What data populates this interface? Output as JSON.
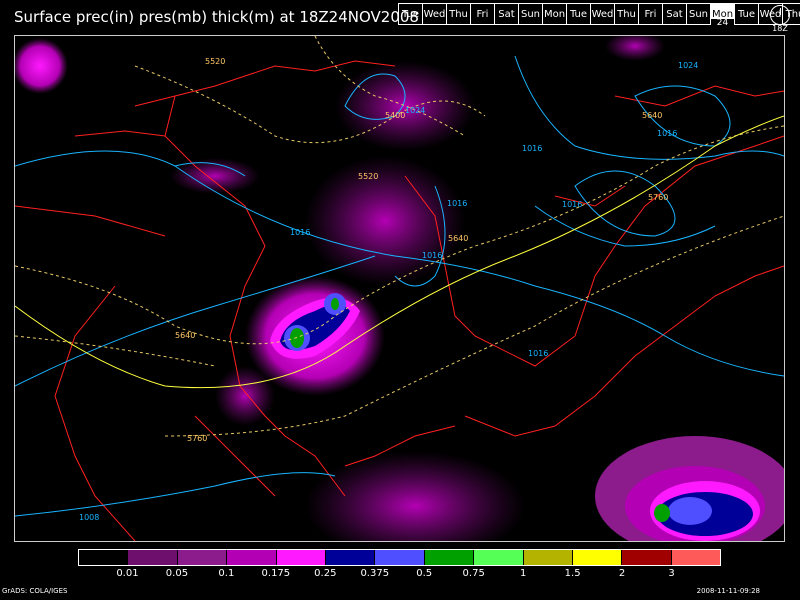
{
  "title": "Surface prec(in) pres(mb) thick(m) at 18Z24NOV2008",
  "days": [
    {
      "label": "Tue"
    },
    {
      "label": "Wed"
    },
    {
      "label": "Thu"
    },
    {
      "label": "Fri"
    },
    {
      "label": "Sat"
    },
    {
      "label": "Sun"
    },
    {
      "label": "Mon"
    },
    {
      "label": "Tue"
    },
    {
      "label": "Wed"
    },
    {
      "label": "Thu"
    },
    {
      "label": "Fri"
    },
    {
      "label": "Sat"
    },
    {
      "label": "Sun"
    },
    {
      "label": "Mon",
      "date": "24",
      "active": true
    },
    {
      "label": "Tue"
    },
    {
      "label": "Wed"
    },
    {
      "label": "Thu"
    }
  ],
  "clock_label": "18Z",
  "map": {
    "pressure_labels": [
      "1016",
      "1016",
      "1016",
      "1016",
      "1016",
      "1016",
      "1016",
      "1024",
      "1024",
      "1008"
    ],
    "thickness_labels": [
      "5520",
      "5400",
      "5520",
      "5640",
      "5640",
      "5760",
      "5760",
      "5640"
    ]
  },
  "legend": {
    "colors": [
      "#000000",
      "#6e0f6e",
      "#8c1c8c",
      "#b400b4",
      "#ff19ff",
      "#000099",
      "#4f4fff",
      "#00a000",
      "#55ff55",
      "#b4b400",
      "#ffff00",
      "#a00000",
      "#ff5a5a"
    ],
    "labels": [
      "0.01",
      "0.05",
      "0.1",
      "0.175",
      "0.25",
      "0.375",
      "0.5",
      "0.75",
      "1",
      "1.5",
      "2",
      "3"
    ]
  },
  "footer": {
    "credit": "GrADS: COLA/IGES",
    "timestamp": "2008-11-11-09:28"
  }
}
